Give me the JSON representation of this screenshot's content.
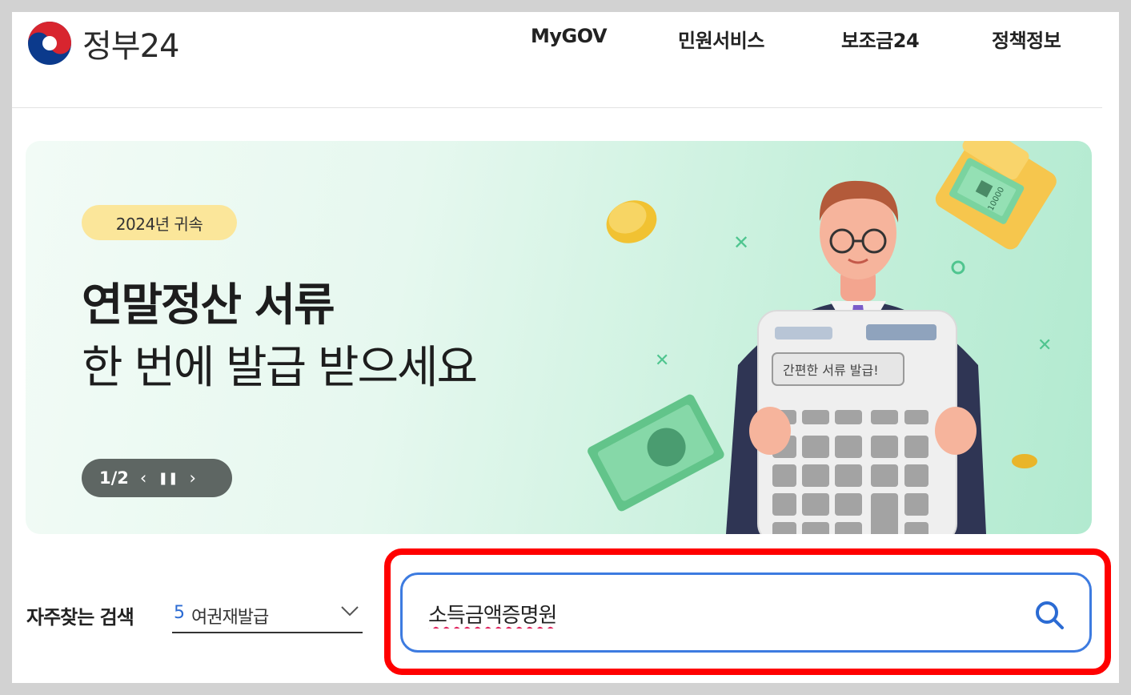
{
  "header": {
    "logo_text": "정부24",
    "nav": [
      {
        "label": "MyGOV"
      },
      {
        "label": "민원서비스"
      },
      {
        "label": "보조금24"
      },
      {
        "label": "정책정보"
      }
    ]
  },
  "banner": {
    "badge": "2024년 귀속",
    "headline": "연말정산 서류",
    "subline": "한 번에 발급 받으세요",
    "pager": "1/2",
    "calculator_text": "간편한 서류 발급!",
    "bill_text": "10000"
  },
  "search": {
    "frequent_label": "자주찾는 검색",
    "frequent_rank": "5",
    "frequent_term": "여권재발급",
    "query": "소득금액증명원"
  },
  "colors": {
    "accent_blue": "#3d7be0",
    "highlight_red": "#ff0000",
    "badge_yellow": "#fbe69a"
  }
}
